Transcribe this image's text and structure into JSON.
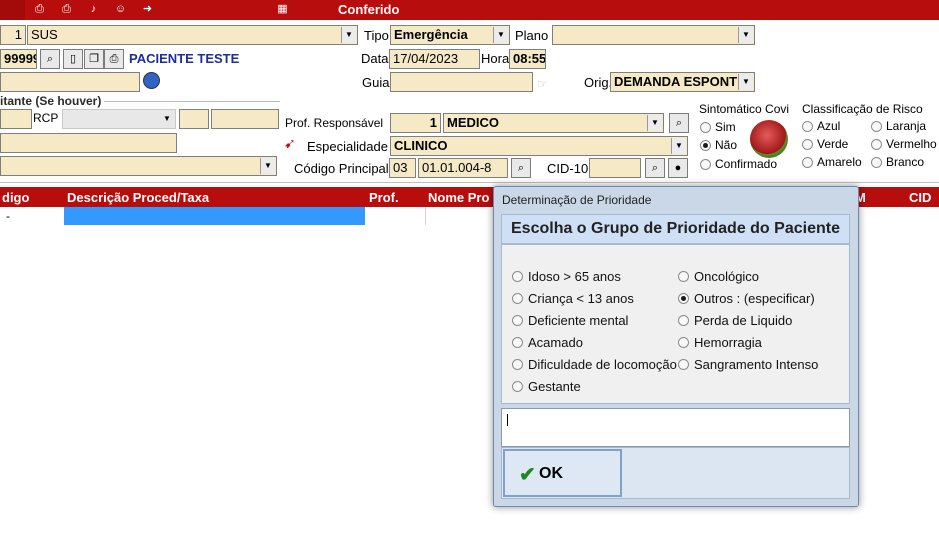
{
  "toolbar": {
    "title": "Conferido",
    "icons": [
      "print-icon",
      "print-icon-2",
      "sound-icon",
      "people-icon",
      "arrow-icon",
      "calculator-icon"
    ]
  },
  "form": {
    "convenio_num": "1",
    "convenio": "SUS",
    "tipo_label": "Tipo",
    "tipo": "Emergência",
    "plano_label": "Plano",
    "plano": "",
    "prontuario": "99999",
    "paciente": "PACIENTE TESTE",
    "data_label": "Data",
    "data": "17/04/2023",
    "hora_label": "Hora",
    "hora": "08:55",
    "guia_label": "Guia",
    "guia": "",
    "orig_label": "Orig.",
    "orig": "DEMANDA ESPONT",
    "solicitante_title": "itante (Se houver)",
    "rcp_label": "RCP",
    "prof_resp_label": "Prof. Responsável",
    "prof_resp_num": "1",
    "prof_resp": "MEDICO",
    "especialidade_label": "Especialidade",
    "especialidade": "CLINICO",
    "codigo_label": "Código Principal",
    "codigo_grupo": "03",
    "codigo": "01.01.004-8",
    "cid_label": "CID-10",
    "cid": "",
    "sintomatico_title": "Sintomático Covi",
    "sintomatico_opts": [
      "Sim",
      "Não",
      "Confirmado"
    ],
    "risco_title": "Classificação de Risco",
    "risco_opts": [
      "Azul",
      "Laranja",
      "Verde",
      "Vermelho",
      "Amarelo",
      "Branco"
    ]
  },
  "table": {
    "headers": [
      "digo",
      "Descrição Proced/Taxa",
      "Prof.",
      "Nome Pro",
      "M",
      "CID"
    ],
    "row1_code": "-"
  },
  "modal": {
    "window_title": "Determinação de Prioridade",
    "heading": "Escolha o Grupo de Prioridade do Paciente",
    "left_options": [
      "Idoso > 65 anos",
      "Criança < 13 anos",
      "Deficiente mental",
      "Acamado",
      "Dificuldade de locomoção",
      "Gestante"
    ],
    "right_options": [
      "Oncológico",
      "Outros : (especificar)",
      "Perda de Liquido",
      "Hemorragia",
      "Sangramento Intenso"
    ],
    "selected": "Outros : (especificar)",
    "input_value": "",
    "ok_label": "OK"
  },
  "colors": {
    "accent_red": "#b80d0d",
    "field_bg": "#f5e9c6",
    "selection_blue": "#3399ff",
    "dialog_bg": "#c9d7e6"
  }
}
